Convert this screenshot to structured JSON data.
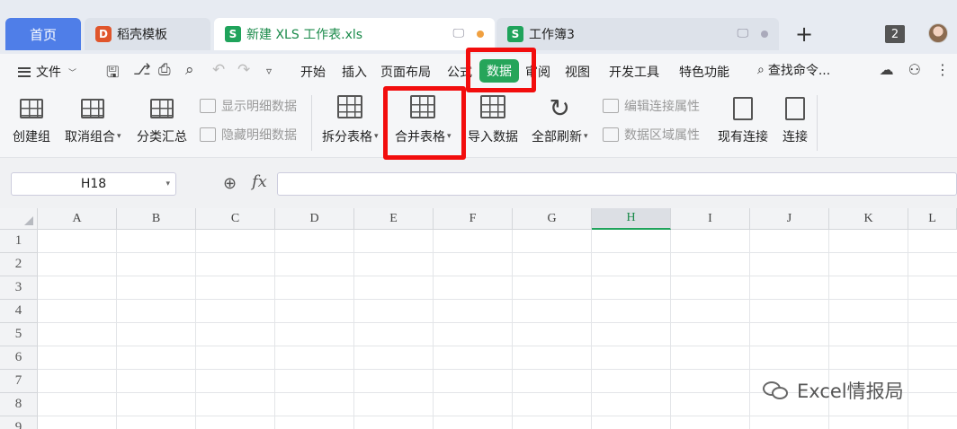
{
  "tabs": {
    "home": "首页",
    "docer": "稻壳模板",
    "docer_logo": "D",
    "file": "新建 XLS 工作表.xls",
    "file_logo": "S",
    "workbook": "工作簿3",
    "new_tab": "+",
    "window_count": "2"
  },
  "menu": {
    "file": "文件",
    "tabs": [
      "开始",
      "插入",
      "页面布局",
      "公式",
      "数据",
      "审阅",
      "视图",
      "开发工具",
      "特色功能"
    ],
    "search": "查找命令...",
    "active_tab": "数据"
  },
  "ribbon": {
    "create_group": "创建组",
    "ungroup": "取消组合",
    "subtotal": "分类汇总",
    "show_detail": "显示明细数据",
    "hide_detail": "隐藏明细数据",
    "split_table": "拆分表格",
    "merge_table": "合并表格",
    "import_data": "导入数据",
    "refresh_all": "全部刷新",
    "edit_conn": "编辑连接属性",
    "range_props": "数据区域属性",
    "existing_conn": "现有连接",
    "connect": "连接"
  },
  "formula": {
    "namebox": "H18",
    "fx": "fx",
    "value": ""
  },
  "sheet": {
    "columns": [
      "A",
      "B",
      "C",
      "D",
      "E",
      "F",
      "G",
      "H",
      "I",
      "J",
      "K",
      "L"
    ],
    "active_column": "H",
    "rows": [
      "1",
      "2",
      "3",
      "4",
      "5",
      "6",
      "7",
      "8",
      "9"
    ]
  },
  "watermark": "Excel情报局",
  "colors": {
    "accent_green": "#26a55a",
    "tab_blue": "#4f7ee8",
    "highlight_red": "#f20d0d"
  }
}
